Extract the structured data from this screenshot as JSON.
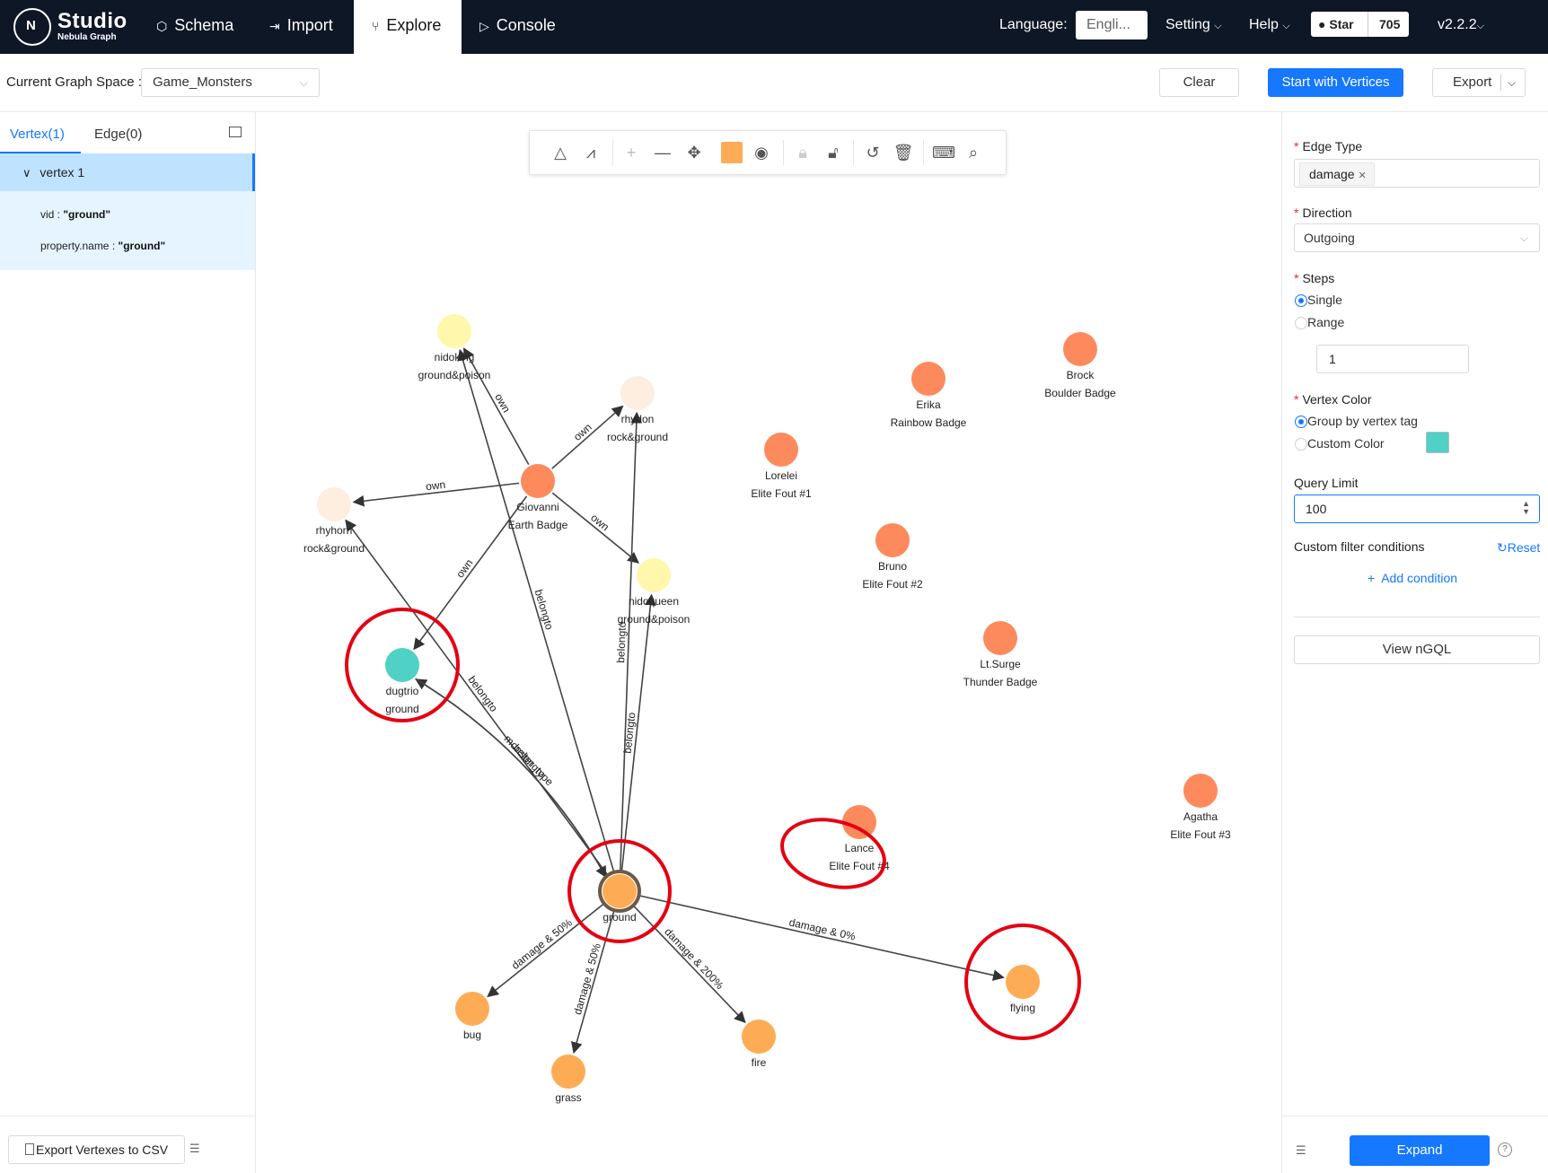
{
  "app": {
    "name": "Studio",
    "subtitle": "Nebula Graph",
    "logo_letter": "N"
  },
  "nav": [
    {
      "label": "Schema",
      "icon": "schema-icon"
    },
    {
      "label": "Import",
      "icon": "import-icon"
    },
    {
      "label": "Explore",
      "icon": "branch-icon",
      "active": true
    },
    {
      "label": "Console",
      "icon": "terminal-icon"
    }
  ],
  "top_right": {
    "language_label": "Language:",
    "language_value": "Engli...",
    "setting": "Setting",
    "help": "Help",
    "star_label": "Star",
    "star_count": "705",
    "version": "v2.2.2"
  },
  "toolbar": {
    "space_label": "Current Graph Space :",
    "space_value": "Game_Monsters",
    "clear": "Clear",
    "start": "Start with Vertices",
    "export": "Export"
  },
  "left": {
    "tab_vertex": "Vertex(1)",
    "tab_edge": "Edge(0)",
    "vertex_title": "vertex 1",
    "props": [
      {
        "key": "vid :",
        "value": "\"ground\""
      },
      {
        "key": "property.name :",
        "value": "\"ground\""
      }
    ],
    "export_csv": "Export Vertexes to CSV"
  },
  "right": {
    "edge_type_label": "Edge Type",
    "edge_type_tag": "damage",
    "direction_label": "Direction",
    "direction_value": "Outgoing",
    "steps_label": "Steps",
    "steps_single": "Single",
    "steps_range": "Range",
    "steps_value": "1",
    "vertex_color_label": "Vertex Color",
    "color_group": "Group by vertex tag",
    "color_custom": "Custom Color",
    "custom_color": "#4fd1c5",
    "query_limit_label": "Query Limit",
    "query_limit_value": "100",
    "filter_label": "Custom filter conditions",
    "reset": "Reset",
    "add_condition": "Add condition",
    "view_ngql": "View nGQL",
    "expand": "Expand"
  },
  "graph": {
    "colors": {
      "badge": "#fc8a5d",
      "type": "#fdac55",
      "pokemon_light": "#fff7ac",
      "pokemon_rock": "#fdeee0",
      "selected": "#4fd1c5",
      "highlight": "#e50012"
    },
    "nodes": [
      {
        "id": "nidoking",
        "l1": "nidoking",
        "l2": "ground&poison",
        "color": "pokemon_light"
      },
      {
        "id": "rhydon",
        "l1": "rhydon",
        "l2": "rock&ground",
        "color": "pokemon_rock"
      },
      {
        "id": "rhyhorn",
        "l1": "rhyhorn",
        "l2": "rock&ground",
        "color": "pokemon_rock"
      },
      {
        "id": "giovanni",
        "l1": "Giovanni",
        "l2": "Earth Badge",
        "color": "badge"
      },
      {
        "id": "nidoqueen",
        "l1": "nidoqueen",
        "l2": "ground&poison",
        "color": "pokemon_light"
      },
      {
        "id": "dugtrio",
        "l1": "dugtrio",
        "l2": "ground",
        "color": "selected"
      },
      {
        "id": "ground",
        "l1": "ground",
        "l2": "",
        "color": "type"
      },
      {
        "id": "bug",
        "l1": "bug",
        "l2": "",
        "color": "type"
      },
      {
        "id": "grass",
        "l1": "grass",
        "l2": "",
        "color": "type"
      },
      {
        "id": "fire",
        "l1": "fire",
        "l2": "",
        "color": "type"
      },
      {
        "id": "flying",
        "l1": "flying",
        "l2": "",
        "color": "type"
      },
      {
        "id": "erika",
        "l1": "Erika",
        "l2": "Rainbow Badge",
        "color": "badge"
      },
      {
        "id": "brock",
        "l1": "Brock",
        "l2": "Boulder Badge",
        "color": "badge"
      },
      {
        "id": "lorelei",
        "l1": "Lorelei",
        "l2": "Elite Fout #1",
        "color": "badge"
      },
      {
        "id": "bruno",
        "l1": "Bruno",
        "l2": "Elite Fout #2",
        "color": "badge"
      },
      {
        "id": "ltsurge",
        "l1": "Lt.Surge",
        "l2": "Thunder Badge",
        "color": "badge"
      },
      {
        "id": "lance",
        "l1": "Lance",
        "l2": "Elite Fout #4",
        "color": "badge"
      },
      {
        "id": "agatha",
        "l1": "Agatha",
        "l2": "Elite Fout #3",
        "color": "badge"
      }
    ],
    "edges": [
      {
        "from": "giovanni",
        "to": "nidoking",
        "label": "own"
      },
      {
        "from": "giovanni",
        "to": "rhydon",
        "label": "own"
      },
      {
        "from": "giovanni",
        "to": "rhyhorn",
        "label": "own"
      },
      {
        "from": "giovanni",
        "to": "nidoqueen",
        "label": "own"
      },
      {
        "from": "giovanni",
        "to": "dugtrio",
        "label": "own"
      },
      {
        "from": "ground",
        "to": "nidoking",
        "label": "belongto"
      },
      {
        "from": "ground",
        "to": "rhydon",
        "label": "belongto"
      },
      {
        "from": "ground",
        "to": "nidoqueen",
        "label": "belongto"
      },
      {
        "from": "ground",
        "to": "rhyhorn",
        "label": "belongto"
      },
      {
        "from": "ground",
        "to": "dugtrio",
        "label": "belongto"
      },
      {
        "from": "dugtrio",
        "to": "ground",
        "label": "monster_type"
      },
      {
        "from": "ground",
        "to": "bug",
        "label": "damage & 50%"
      },
      {
        "from": "ground",
        "to": "grass",
        "label": "damage & 50%"
      },
      {
        "from": "ground",
        "to": "fire",
        "label": "damage & 200%"
      },
      {
        "from": "ground",
        "to": "flying",
        "label": "damage & 0%"
      }
    ]
  }
}
